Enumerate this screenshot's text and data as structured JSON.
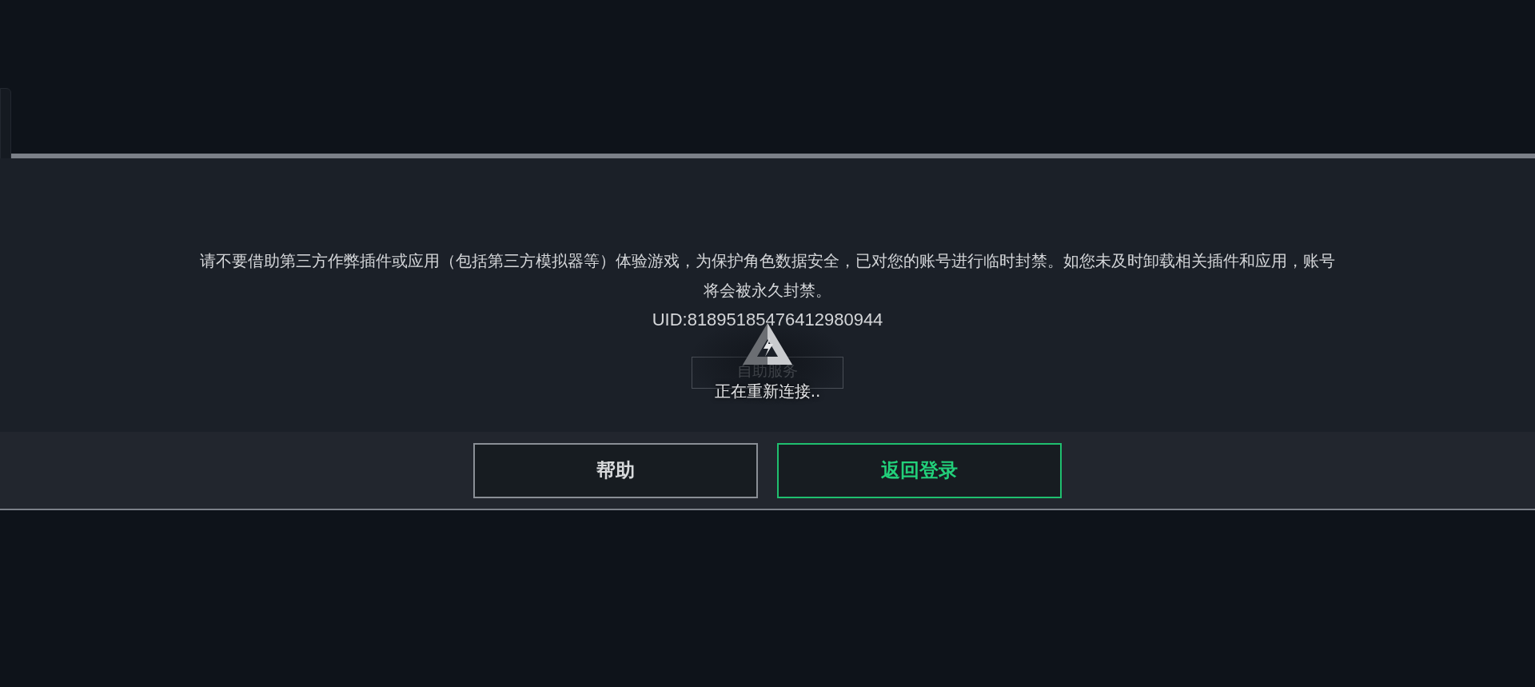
{
  "dialog": {
    "message": "请不要借助第三方作弊插件或应用（包括第三方模拟器等）体验游戏，为保护角色数据安全，已对您的账号进行临时封禁。如您未及时卸载相关插件和应用，账号将会被永久封禁。",
    "uid": "UID:81895185476412980944",
    "self_service_button": "自助服务"
  },
  "buttons": [
    {
      "label": "帮助",
      "kind": "secondary"
    },
    {
      "label": "返回登录",
      "kind": "primary"
    }
  ],
  "loading": {
    "text": "正在重新连接.."
  }
}
